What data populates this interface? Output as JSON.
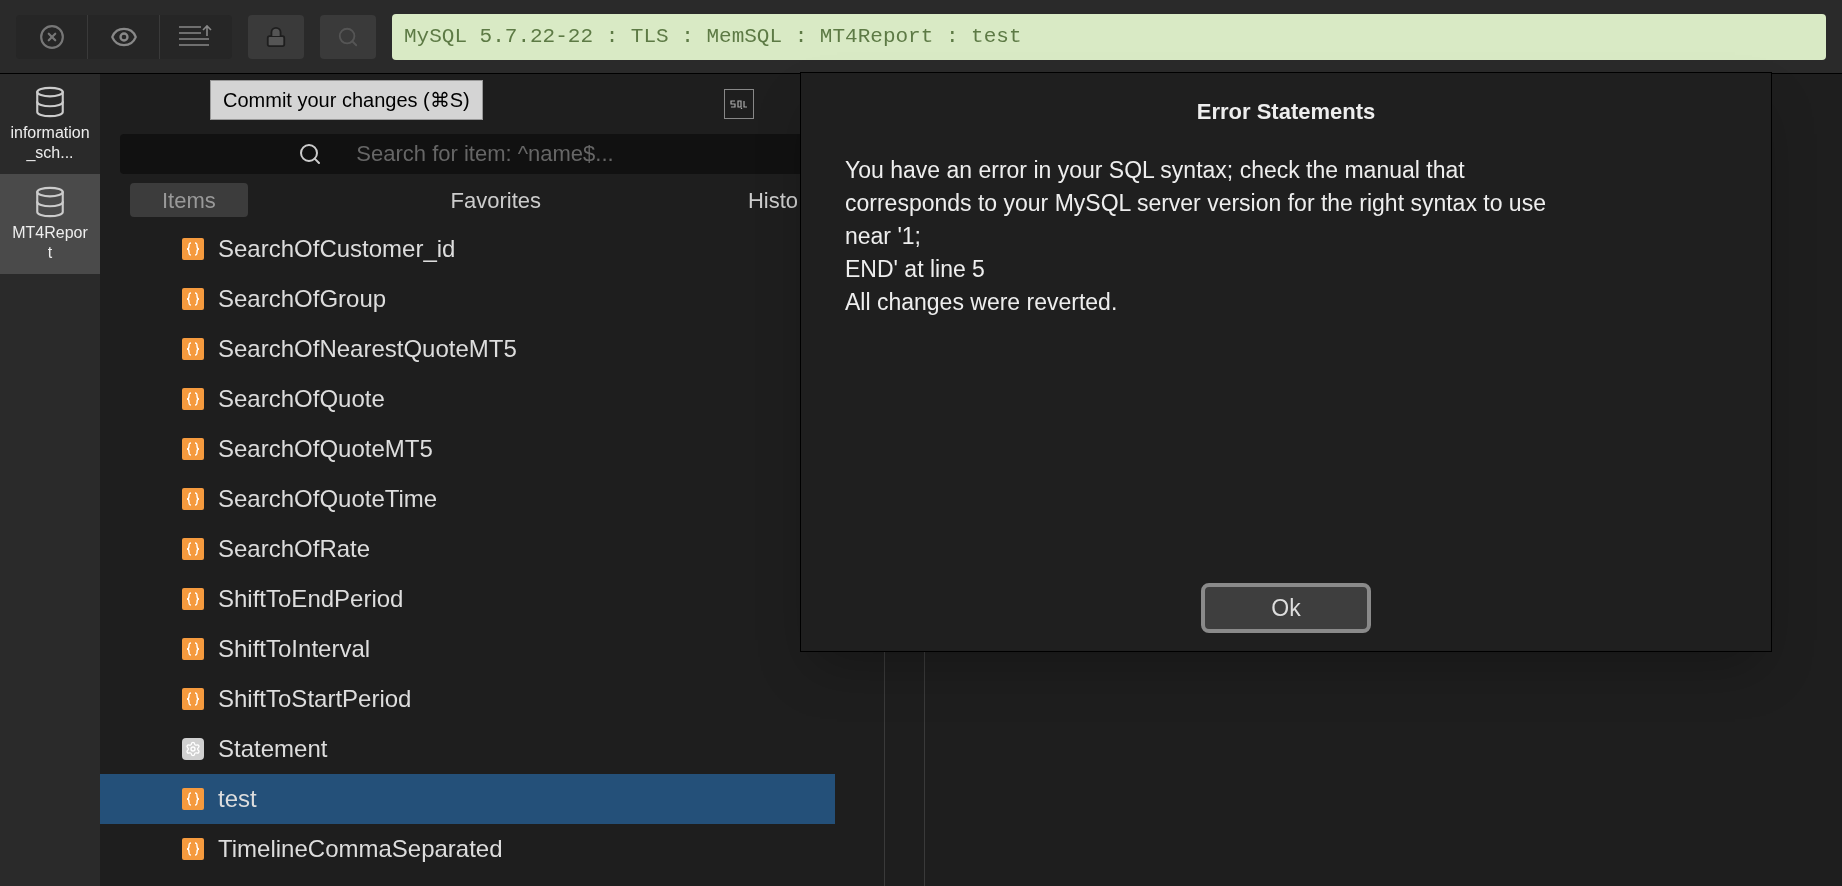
{
  "toolbar": {
    "connection": "MySQL 5.7.22-22 : TLS : MemSQL : MT4Report : test",
    "tooltip": "Commit your changes (⌘S)"
  },
  "databases": [
    {
      "name": "information_sch...",
      "selected": false
    },
    {
      "name": "MT4Report",
      "selected": true
    }
  ],
  "search": {
    "placeholder": "Search for item: ^name$..."
  },
  "tabs": [
    {
      "label": "Items",
      "selected": true
    },
    {
      "label": "Favorites",
      "selected": false
    },
    {
      "label": "Histo",
      "selected": false
    }
  ],
  "items": [
    {
      "name": "SearchOfCustomer_id",
      "kind": "function",
      "selected": false
    },
    {
      "name": "SearchOfGroup",
      "kind": "function",
      "selected": false
    },
    {
      "name": "SearchOfNearestQuoteMT5",
      "kind": "function",
      "selected": false
    },
    {
      "name": "SearchOfQuote",
      "kind": "function",
      "selected": false
    },
    {
      "name": "SearchOfQuoteMT5",
      "kind": "function",
      "selected": false
    },
    {
      "name": "SearchOfQuoteTime",
      "kind": "function",
      "selected": false
    },
    {
      "name": "SearchOfRate",
      "kind": "function",
      "selected": false
    },
    {
      "name": "ShiftToEndPeriod",
      "kind": "function",
      "selected": false
    },
    {
      "name": "ShiftToInterval",
      "kind": "function",
      "selected": false
    },
    {
      "name": "ShiftToStartPeriod",
      "kind": "function",
      "selected": false
    },
    {
      "name": "Statement",
      "kind": "statement",
      "selected": false
    },
    {
      "name": "test",
      "kind": "function",
      "selected": true
    },
    {
      "name": "TimelineCommaSeparated",
      "kind": "function",
      "selected": false
    }
  ],
  "dialog": {
    "title": "Error Statements",
    "lines": [
      "You have an error in your SQL syntax; check the manual that corresponds to your MySQL server version for the right syntax to use near '1;",
      "END' at line 5",
      "All changes were reverted."
    ],
    "button": "Ok"
  }
}
